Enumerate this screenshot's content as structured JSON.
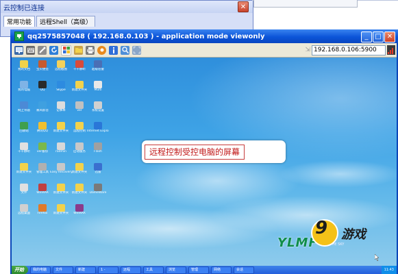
{
  "back_window": {
    "title": "云控制已连接",
    "close_symbol": "✕",
    "tabs": [
      "常用功能",
      "远程Shell（高级）"
    ]
  },
  "main_window": {
    "title": "qq2575857048 ( 192.168.0.103 ) - application mode viewonly",
    "minimize_symbol": "_",
    "maximize_symbol": "□",
    "close_symbol": "✕",
    "host_field_value": "192.168.0.106:5900",
    "toolbar_icons": [
      "monitor-icon",
      "keyboard-icon",
      "tools-icon",
      "refresh-icon",
      "windows-logo-icon",
      "folder-icon",
      "printer-icon",
      "record-icon",
      "info-icon",
      "zoom-icon",
      "fullscreen-icon"
    ]
  },
  "desktop": {
    "annotation": "远程控制受控电脑的屏幕",
    "brand": "YLMF",
    "brand_sub": "AND THE SKY",
    "icons": [
      {
        "label": "我的文档",
        "color": "#f2d24b"
      },
      {
        "label": "宝贝便签",
        "color": "#c65a2f"
      },
      {
        "label": "远程截图",
        "color": "#f4d15a"
      },
      {
        "label": "千千静听",
        "color": "#d94a3a"
      },
      {
        "label": "超级巡警",
        "color": "#4a6fb5"
      },
      {
        "label": "我的电脑",
        "color": "#7fb3e6"
      },
      {
        "label": "QQ",
        "color": "#2a2a2a"
      },
      {
        "label": "Skype",
        "color": "#2d8be0"
      },
      {
        "label": "新建文件夹",
        "color": "#f2d24b"
      },
      {
        "label": "Multi",
        "color": "#e8e8e8"
      },
      {
        "label": "网上邻居",
        "color": "#4c8ad6"
      },
      {
        "label": "暴风影音",
        "color": "#3fa0e0"
      },
      {
        "label": "记事本",
        "color": "#dcdcdc"
      },
      {
        "label": "ver",
        "color": "#c0c0c0"
      },
      {
        "label": "系统设置",
        "color": "#d0d0d0"
      },
      {
        "label": "回收站",
        "color": "#3f9f4f"
      },
      {
        "label": "腾讯QQ",
        "color": "#f0c030"
      },
      {
        "label": "新建文件夹",
        "color": "#f2d24b"
      },
      {
        "label": "远程控制",
        "color": "#f2d24b"
      },
      {
        "label": "Internet Explorer",
        "color": "#2a77d8"
      },
      {
        "label": "千千静听",
        "color": "#e0e0e0"
      },
      {
        "label": "ver备份",
        "color": "#7ab84a"
      },
      {
        "label": "radmin",
        "color": "#d8d8d8"
      },
      {
        "label": "启动服务",
        "color": "#c8c8c8"
      },
      {
        "label": "Flash",
        "color": "#a0a0a0"
      },
      {
        "label": "新建文件夹",
        "color": "#f2d24b"
      },
      {
        "label": "管理工具",
        "color": "#b0b0b0"
      },
      {
        "label": "Easy Recovery",
        "color": "#c8c8c8"
      },
      {
        "label": "新建文件夹",
        "color": "#f2d24b"
      },
      {
        "label": "迅雷",
        "color": "#3a6fcf"
      },
      {
        "label": "文件",
        "color": "#e0e0e0"
      },
      {
        "label": "WinRAR",
        "color": "#c04040"
      },
      {
        "label": "新建文件夹",
        "color": "#f2d24b"
      },
      {
        "label": "新建文件夹",
        "color": "#f2d24b"
      },
      {
        "label": "DameWare",
        "color": "#7a7a7a"
      },
      {
        "label": "远程桌面",
        "color": "#d0d0d0"
      },
      {
        "label": "Firefox",
        "color": "#e07a2a"
      },
      {
        "label": "新建文件夹",
        "color": "#f2d24b"
      },
      {
        "label": "WinRAR",
        "color": "#8b3a8b"
      }
    ]
  },
  "taskbar": {
    "start_label": "开始",
    "items": [
      "我的电脑",
      "文件",
      "新建",
      "1 -",
      "远程",
      "工具",
      "浏览",
      "管理",
      "网络",
      "会话"
    ],
    "tray": "11:43"
  },
  "watermark": {
    "number": "9",
    "text": "游戏"
  }
}
